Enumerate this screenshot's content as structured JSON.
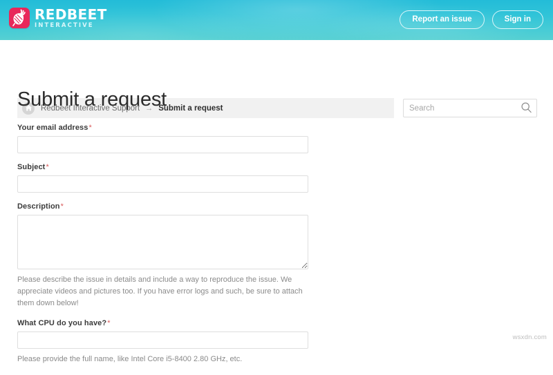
{
  "header": {
    "brand": {
      "name": "REDBEET",
      "tagline": "INTERACTIVE",
      "icon": "beet-logo-icon",
      "mark_color": "#e8275a"
    },
    "actions": [
      {
        "label": "Report an issue",
        "name": "report-an-issue-button"
      },
      {
        "label": "Sign in",
        "name": "sign-in-button"
      }
    ],
    "gradient_from": "#23bcd8",
    "gradient_to": "#56d0d2"
  },
  "breadcrumb": {
    "home_icon": "home-icon",
    "root": "Redbeet Interactive Support",
    "separator": "→",
    "current": "Submit a request"
  },
  "search": {
    "placeholder": "Search",
    "value": "",
    "icon": "search-icon"
  },
  "main": {
    "title": "Submit a request",
    "required_marker": "*",
    "fields": [
      {
        "name": "email-field",
        "label": "Your email address",
        "required": true,
        "type": "text",
        "value": "",
        "help": ""
      },
      {
        "name": "subject-field",
        "label": "Subject",
        "required": true,
        "type": "text",
        "value": "",
        "help": ""
      },
      {
        "name": "description-field",
        "label": "Description",
        "required": true,
        "type": "textarea",
        "value": "",
        "help": "Please describe the issue in details and include a way to reproduce the issue. We appreciate videos and pictures too. If you have error logs and such, be sure to attach them down below!"
      },
      {
        "name": "cpu-field",
        "label": "What CPU do you have?",
        "required": true,
        "type": "text",
        "value": "",
        "help": "Please provide the full name, like Intel Core i5-8400 2.80 GHz, etc."
      }
    ]
  },
  "watermark": "wsxdn.com"
}
